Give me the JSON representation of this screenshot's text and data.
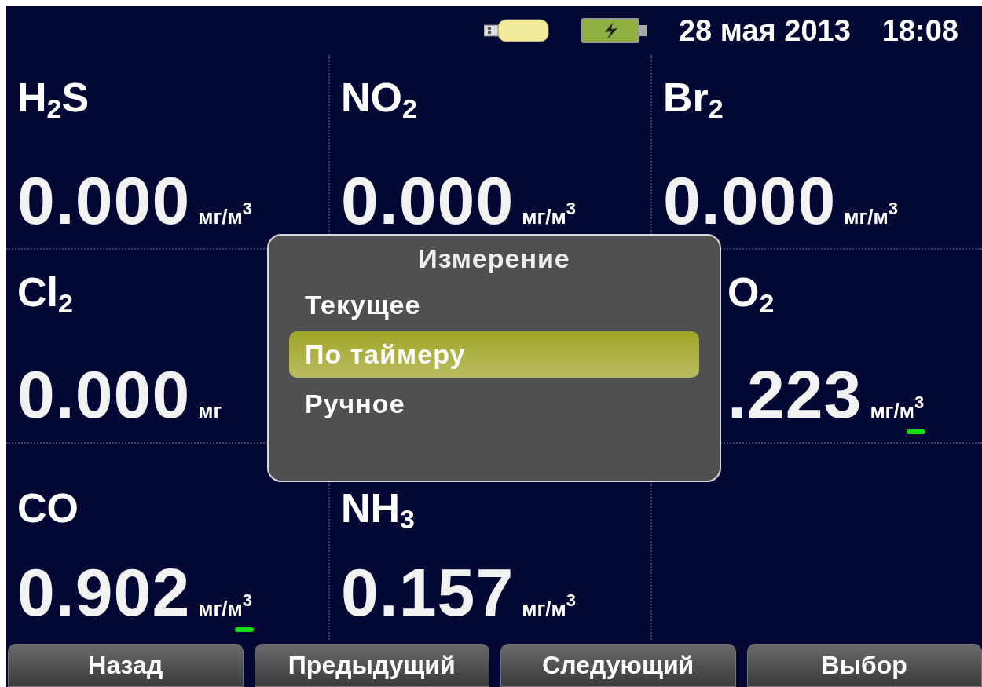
{
  "status_bar": {
    "date": "28 мая 2013",
    "time": "18:08"
  },
  "cells": [
    {
      "name": "H$_{2}$S",
      "value": "0.000",
      "unit": "мг/м$^{3}$"
    },
    {
      "name": "NO$_{2}$",
      "value": "0.000",
      "unit": "мг/м$^{3}$"
    },
    {
      "name": "Br$_{2}$",
      "value": "0.000",
      "unit": "мг/м$^{3}$"
    },
    {
      "name": "Cl$_{2}$",
      "value": "0.000",
      "unit": "мг"
    },
    {},
    {
      "name": "O$_{2}$",
      "value": ".223",
      "unit": "мг/м$^{3}$",
      "indicator": true
    },
    {
      "name": "CO",
      "value": "0.902",
      "unit": "мг/м$^{3}$",
      "indicator": true
    },
    {
      "name": "NH$_{3}$",
      "value": "0.157",
      "unit": "мг/м$^{3}$"
    },
    {}
  ],
  "dialog": {
    "title": "Измерение",
    "items": [
      {
        "label": "Текущее",
        "selected": false
      },
      {
        "label": "По таймеру",
        "selected": true
      },
      {
        "label": "Ручное",
        "selected": false
      }
    ]
  },
  "buttons": [
    "Назад",
    "Предыдущий",
    "Следующий",
    "Выбор"
  ]
}
